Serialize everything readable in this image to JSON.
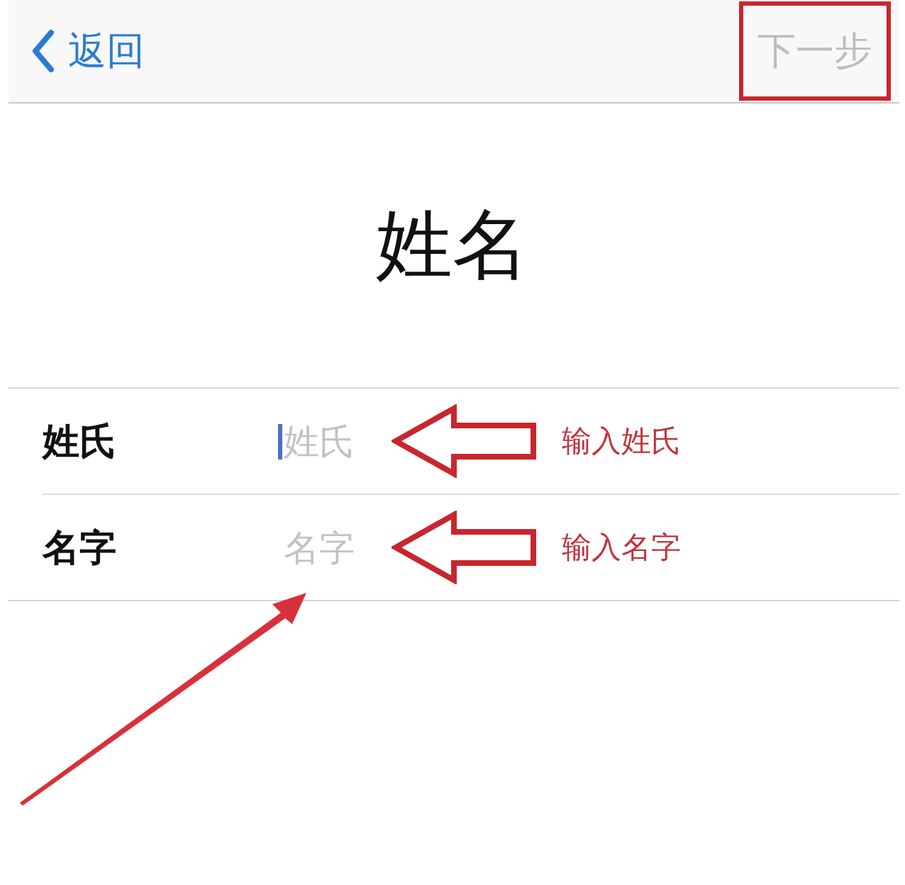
{
  "nav_bar": {
    "back": {
      "label": "返回"
    },
    "next": {
      "label": "下一步",
      "disabled": true,
      "highlighted": true
    }
  },
  "title": "姓名",
  "fields": [
    {
      "label": "姓氏",
      "placeholder": "姓氏",
      "focused": true,
      "note": "输入姓氏"
    },
    {
      "label": "名字",
      "placeholder": "名字",
      "focused": false,
      "note": "输入名字"
    }
  ]
}
